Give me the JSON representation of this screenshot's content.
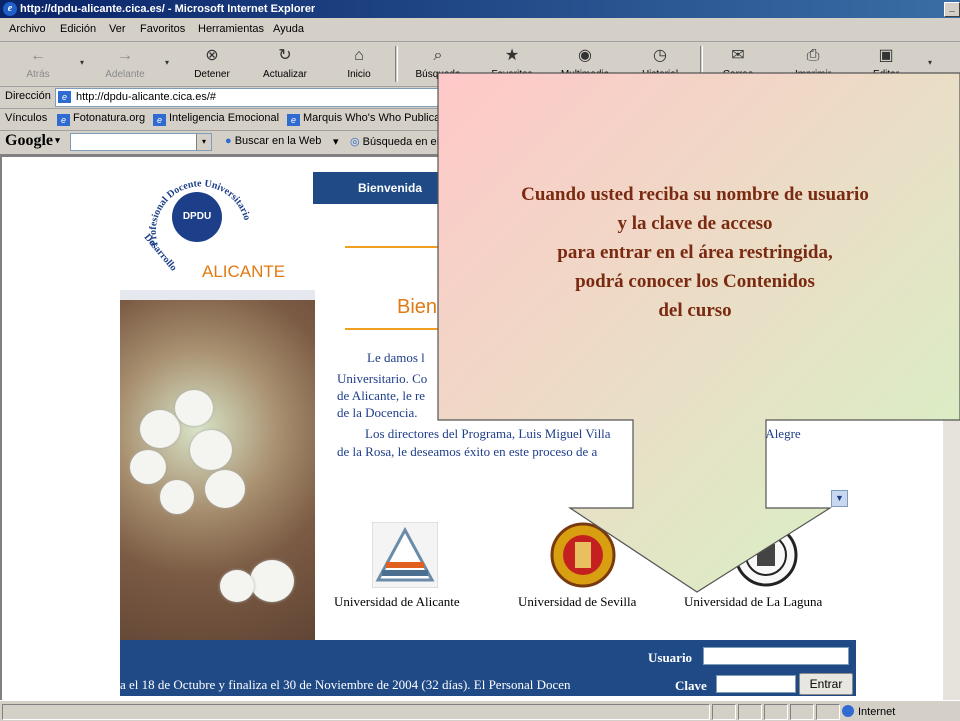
{
  "window": {
    "title": "http://dpdu-alicante.cica.es/ - Microsoft Internet Explorer",
    "min_glyph": "_"
  },
  "menu": [
    "Archivo",
    "Edición",
    "Ver",
    "Favoritos",
    "Herramientas",
    "Ayuda"
  ],
  "toolbar": {
    "back": "Atrás",
    "forward": "Adelante",
    "stop": "Detener",
    "refresh": "Actualizar",
    "home": "Inicio",
    "search": "Búsqueda",
    "favorites": "Favoritos",
    "media": "Multimedia",
    "history": "Historial",
    "mail": "Correo",
    "print": "Imprimir",
    "edit": "Editar"
  },
  "address": {
    "label": "Dirección",
    "url": "http://dpdu-alicante.cica.es/#"
  },
  "links": {
    "label": "Vínculos",
    "items": [
      "Fotonatura.org",
      "Inteligencia Emocional",
      "Marquis Who's Who Publicati"
    ]
  },
  "google": {
    "logo": "Google",
    "search_web": "Buscar en la Web",
    "search_site": "Búsqueda en el"
  },
  "status": {
    "zone": "Internet"
  },
  "page": {
    "logo_arc": "Profesional Docente Universitario",
    "logo_arc_bottom": "Desarrollo",
    "logo_badge": "DPDU",
    "logo_city": "ALICANTE",
    "nav_welcome": "Bienvenida",
    "welcome_heading": "Bien",
    "body_lines": [
      "Le damos l",
      "Universitario. Co",
      "de Alicante, le re",
      "de la Docencia.",
      "Los directores del Programa, Luis Miguel Villa",
      "a Alegre",
      "de la Rosa, le deseamos éxito en este proceso de a"
    ],
    "universities": [
      "Universidad de Alicante",
      "Universidad de Sevilla",
      "Universidad de La Laguna"
    ],
    "marquee": "a el 18 de Octubre y finaliza el 30 de Noviembre de 2004 (32 días). El Personal Docen",
    "login": {
      "user_label": "Usuario",
      "password_label": "Clave",
      "submit": "Entrar"
    }
  },
  "callout": {
    "lines": [
      "Cuando usted reciba su nombre de usuario",
      "y la clave de acceso",
      "para entrar en el área restringida,",
      "podrá conocer los Contenidos",
      "del curso"
    ],
    "gradient_start": "#ffc8c8",
    "gradient_end": "#d4f4c4"
  },
  "colors": {
    "nav_blue": "#1f4a86",
    "orange": "#e07a13",
    "text_blue": "#1f3e8a"
  }
}
